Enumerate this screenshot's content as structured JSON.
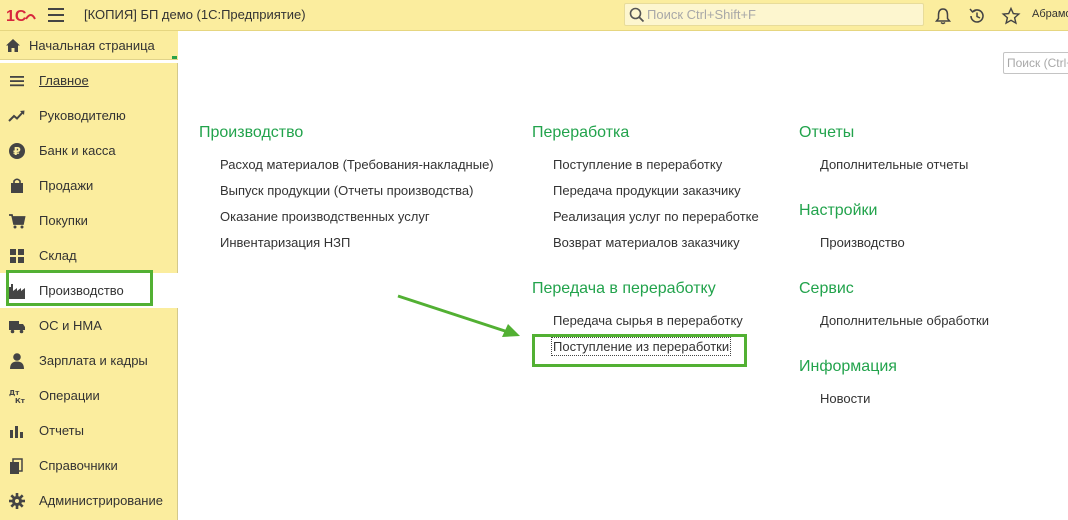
{
  "titlebar": {
    "logo_text": "1С",
    "app_title": "[КОПИЯ] БП демо  (1С:Предприятие)",
    "search_placeholder": "Поиск Ctrl+Shift+F",
    "user_name": "Абрамо",
    "icons": [
      "menu-icon",
      "search-icon",
      "bell-icon",
      "history-icon",
      "star-icon"
    ]
  },
  "homebar": {
    "label": "Начальная страница",
    "icon": "home-icon"
  },
  "sidebar": {
    "items": [
      {
        "label": "Главное",
        "icon": "menu-lines-icon",
        "underline": true
      },
      {
        "label": "Руководителю",
        "icon": "trend-icon"
      },
      {
        "label": "Банк и касса",
        "icon": "ruble-icon"
      },
      {
        "label": "Продажи",
        "icon": "bag-icon"
      },
      {
        "label": "Покупки",
        "icon": "cart-icon"
      },
      {
        "label": "Склад",
        "icon": "warehouse-icon"
      },
      {
        "label": "Производство",
        "icon": "factory-icon",
        "active": true
      },
      {
        "label": "ОС и НМА",
        "icon": "truck-icon"
      },
      {
        "label": "Зарплата и кадры",
        "icon": "person-icon"
      },
      {
        "label": "Операции",
        "icon": "dt-kt-icon"
      },
      {
        "label": "Отчеты",
        "icon": "bar-chart-icon"
      },
      {
        "label": "Справочники",
        "icon": "books-icon"
      },
      {
        "label": "Администрирование",
        "icon": "gear-icon"
      }
    ]
  },
  "main": {
    "search_placeholder": "Поиск (Ctrl+F)",
    "sections": {
      "production": {
        "title": "Производство",
        "links": [
          "Расход материалов (Требования-накладные)",
          "Выпуск продукции (Отчеты производства)",
          "Оказание производственных услуг",
          "Инвентаризация НЗП"
        ]
      },
      "processing": {
        "title": "Переработка",
        "links": [
          "Поступление в переработку",
          "Передача продукции заказчику",
          "Реализация услуг по переработке",
          "Возврат материалов заказчику"
        ]
      },
      "transfer": {
        "title": "Передача в переработку",
        "links": [
          "Передача сырья в переработку",
          "Поступление из переработки"
        ]
      },
      "reports": {
        "title": "Отчеты",
        "links": [
          "Дополнительные отчеты"
        ]
      },
      "settings": {
        "title": "Настройки",
        "links": [
          "Производство"
        ]
      },
      "service": {
        "title": "Сервис",
        "links": [
          "Дополнительные обработки"
        ]
      },
      "info": {
        "title": "Информация",
        "links": [
          "Новости"
        ]
      }
    }
  },
  "colors": {
    "panel_yellow": "#fbed9e",
    "section_green": "#22a34c",
    "highlight_green": "#52b033",
    "logo_red": "#d7263d"
  }
}
